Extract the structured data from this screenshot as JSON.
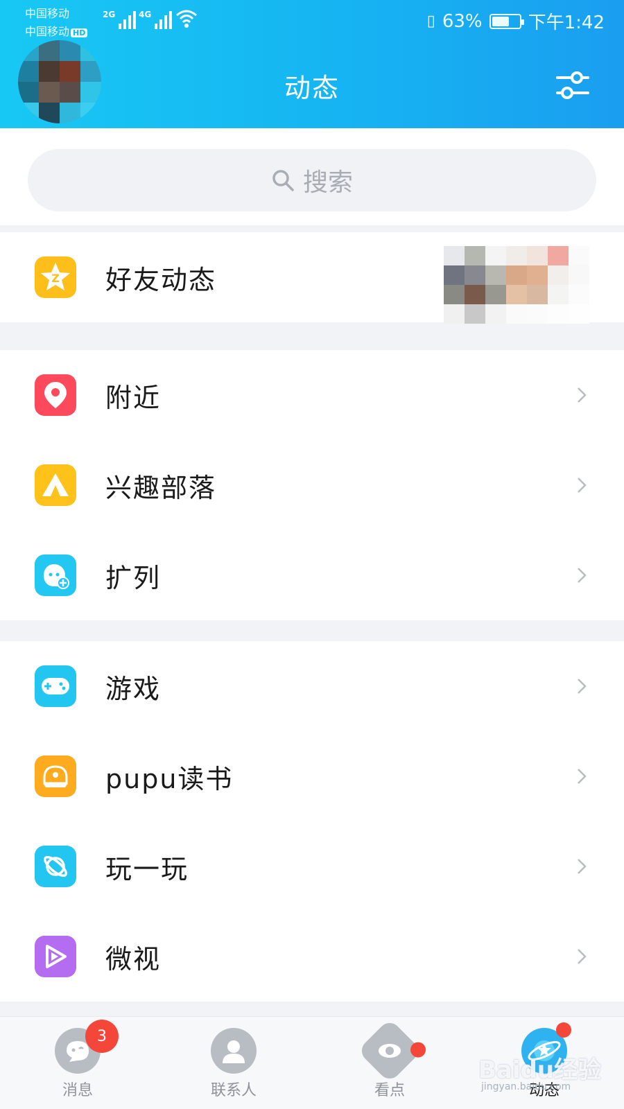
{
  "status_bar": {
    "carrier1": "中国移动",
    "carrier2": "中国移动",
    "hd": "HD",
    "net1": "2G",
    "net2": "4G",
    "battery_percent": "63%",
    "battery_level": 0.63,
    "time": "下午1:42"
  },
  "header": {
    "title": "动态"
  },
  "search": {
    "placeholder": "搜索"
  },
  "sections": [
    [
      {
        "label": "好友动态",
        "icon": "qzone-star-icon",
        "color": "#ffbf1a"
      }
    ],
    [
      {
        "label": "附近",
        "icon": "location-pin-icon",
        "color": "#fc4a5c"
      },
      {
        "label": "兴趣部落",
        "icon": "tent-icon",
        "color": "#ffc21a"
      },
      {
        "label": "扩列",
        "icon": "add-friend-icon",
        "color": "#22c8f2"
      }
    ],
    [
      {
        "label": "游戏",
        "icon": "gamepad-icon",
        "color": "#22c6f0"
      },
      {
        "label": "pupu读书",
        "icon": "book-icon",
        "color": "#ffab1f"
      },
      {
        "label": "玩一玩",
        "icon": "planet-icon",
        "color": "#22c6f0"
      },
      {
        "label": "微视",
        "icon": "play-icon",
        "color": "#b46cf0"
      }
    ]
  ],
  "bottom_nav": [
    {
      "label": "消息",
      "icon": "message-icon",
      "badge": "3",
      "active": false
    },
    {
      "label": "联系人",
      "icon": "contacts-icon",
      "badge": "",
      "active": false
    },
    {
      "label": "看点",
      "icon": "eye-icon",
      "badge": "dot",
      "active": false
    },
    {
      "label": "动态",
      "icon": "planet-star-icon",
      "badge": "dot",
      "active": true
    }
  ],
  "watermark": {
    "text": "Baidu经验",
    "sub": "jingyan.baidu.com"
  },
  "colors": {
    "header_gradient_start": "#18c8f4",
    "header_gradient_end": "#1a9ef0",
    "badge": "#f4473a"
  }
}
